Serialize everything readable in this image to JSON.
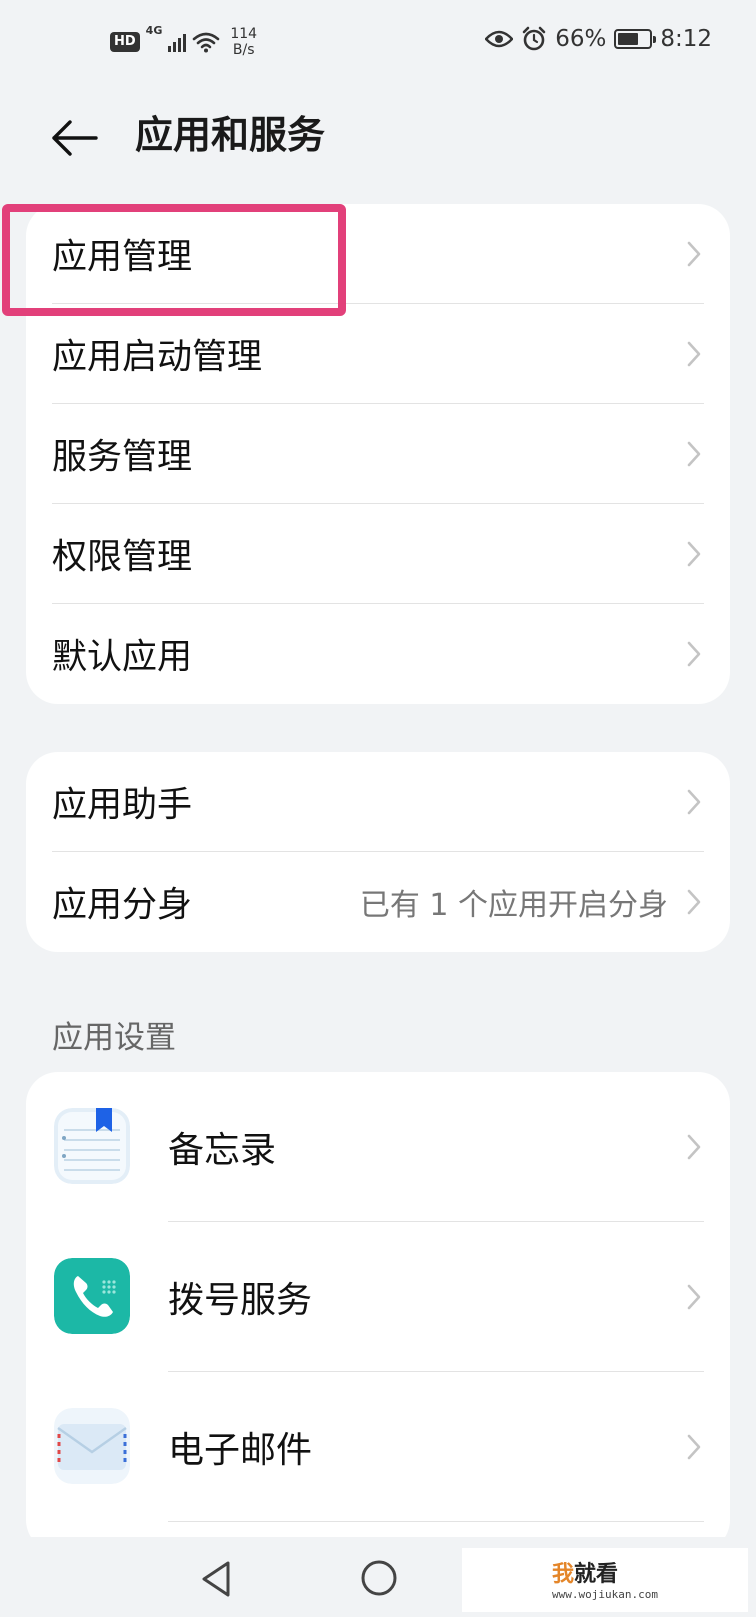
{
  "status_bar": {
    "hd_badge": "HD",
    "network_type": "4G",
    "speed_value": "114",
    "speed_unit": "B/s",
    "battery_percent": "66%",
    "battery_level": 0.66,
    "time": "8:12",
    "icons": [
      "hd-icon",
      "signal-icon",
      "wifi-icon",
      "eye-comfort-icon",
      "alarm-icon",
      "battery-saver-icon"
    ]
  },
  "header": {
    "back_icon": "arrow-left-icon",
    "title": "应用和服务"
  },
  "group1": {
    "items": [
      {
        "label": "应用管理"
      },
      {
        "label": "应用启动管理"
      },
      {
        "label": "服务管理"
      },
      {
        "label": "权限管理"
      },
      {
        "label": "默认应用"
      }
    ]
  },
  "group2": {
    "items": [
      {
        "label": "应用助手",
        "value": ""
      },
      {
        "label": "应用分身",
        "value": "已有 1 个应用开启分身"
      }
    ]
  },
  "app_settings": {
    "header": "应用设置",
    "items": [
      {
        "label": "备忘录",
        "icon": "notepad-icon"
      },
      {
        "label": "拨号服务",
        "icon": "phone-icon"
      },
      {
        "label": "电子邮件",
        "icon": "mail-icon"
      }
    ]
  },
  "highlight": {
    "color": "#e2407a",
    "target": "应用管理"
  },
  "nav_bar": {
    "icons": [
      "nav-back-icon",
      "nav-home-icon"
    ]
  },
  "watermark": {
    "first_char": "我",
    "rest_text": "就看",
    "url": "www.wojiukan.com"
  },
  "colors": {
    "background": "#f1f3f5",
    "card": "#ffffff",
    "text_primary": "#111111",
    "text_secondary": "#777777",
    "chevron": "#c4c4c4",
    "phone_icon_bg": "#1cb8a6"
  }
}
